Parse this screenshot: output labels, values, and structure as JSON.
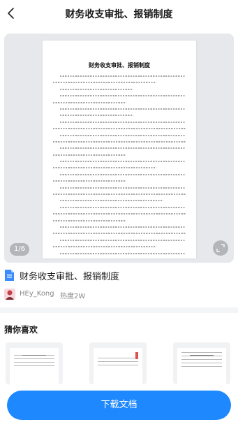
{
  "header": {
    "title": "财务收支审批、报销制度"
  },
  "preview": {
    "document_heading": "财务收支审批、报销制度",
    "page_indicator": "1/6"
  },
  "doc_info": {
    "name": "财务收支审批、报销制度"
  },
  "author": {
    "name": "HEy_Kong",
    "hotness": "热度2W"
  },
  "recommendations": {
    "title": "猜你喜欢"
  },
  "actions": {
    "download_label": "下载文档"
  },
  "colors": {
    "accent": "#1e88ff",
    "doc_icon": "#3b8cff"
  },
  "icons": {
    "back": "chevron-left-icon",
    "expand": "expand-icon",
    "document": "document-icon"
  }
}
